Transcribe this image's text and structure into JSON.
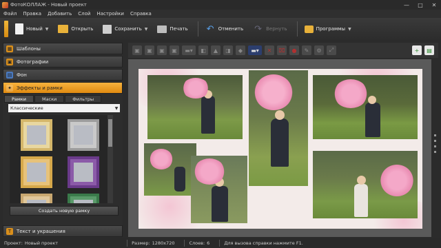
{
  "window": {
    "title": "ФотоКОЛЛАЖ - Новый проект",
    "minimize": "—",
    "maximize": "□",
    "close": "✕"
  },
  "menu": [
    "Файл",
    "Правка",
    "Добавить",
    "Слой",
    "Настройки",
    "Справка"
  ],
  "toolbar": {
    "new": "Новый",
    "open": "Открыть",
    "save": "Сохранить",
    "print": "Печать",
    "undo": "Отменить",
    "redo": "Вернуть",
    "programs": "Программы"
  },
  "panel": {
    "sections": [
      "Шаблоны",
      "Фотографии",
      "Фон",
      "Эффекты и рамки",
      "Текст и украшения"
    ],
    "tabs": [
      "Рамки",
      "Маски",
      "Фильтры"
    ],
    "category": "Классические",
    "create_frame": "Создать новую рамку",
    "frames": [
      {
        "color": "#d4b66a"
      },
      {
        "color": "#9c9c9c"
      },
      {
        "color": "#d6a84a"
      },
      {
        "color": "#6a3a8a"
      },
      {
        "color": "#c9a870"
      },
      {
        "color": "#3a7a4a"
      }
    ]
  },
  "status": {
    "project_label": "Проект:",
    "project": "Новый проект",
    "size_label": "Размер:",
    "size": "1280x720",
    "layers_label": "Слоев:",
    "layers": "6",
    "help": "Для вызова справки нажмите F1."
  }
}
